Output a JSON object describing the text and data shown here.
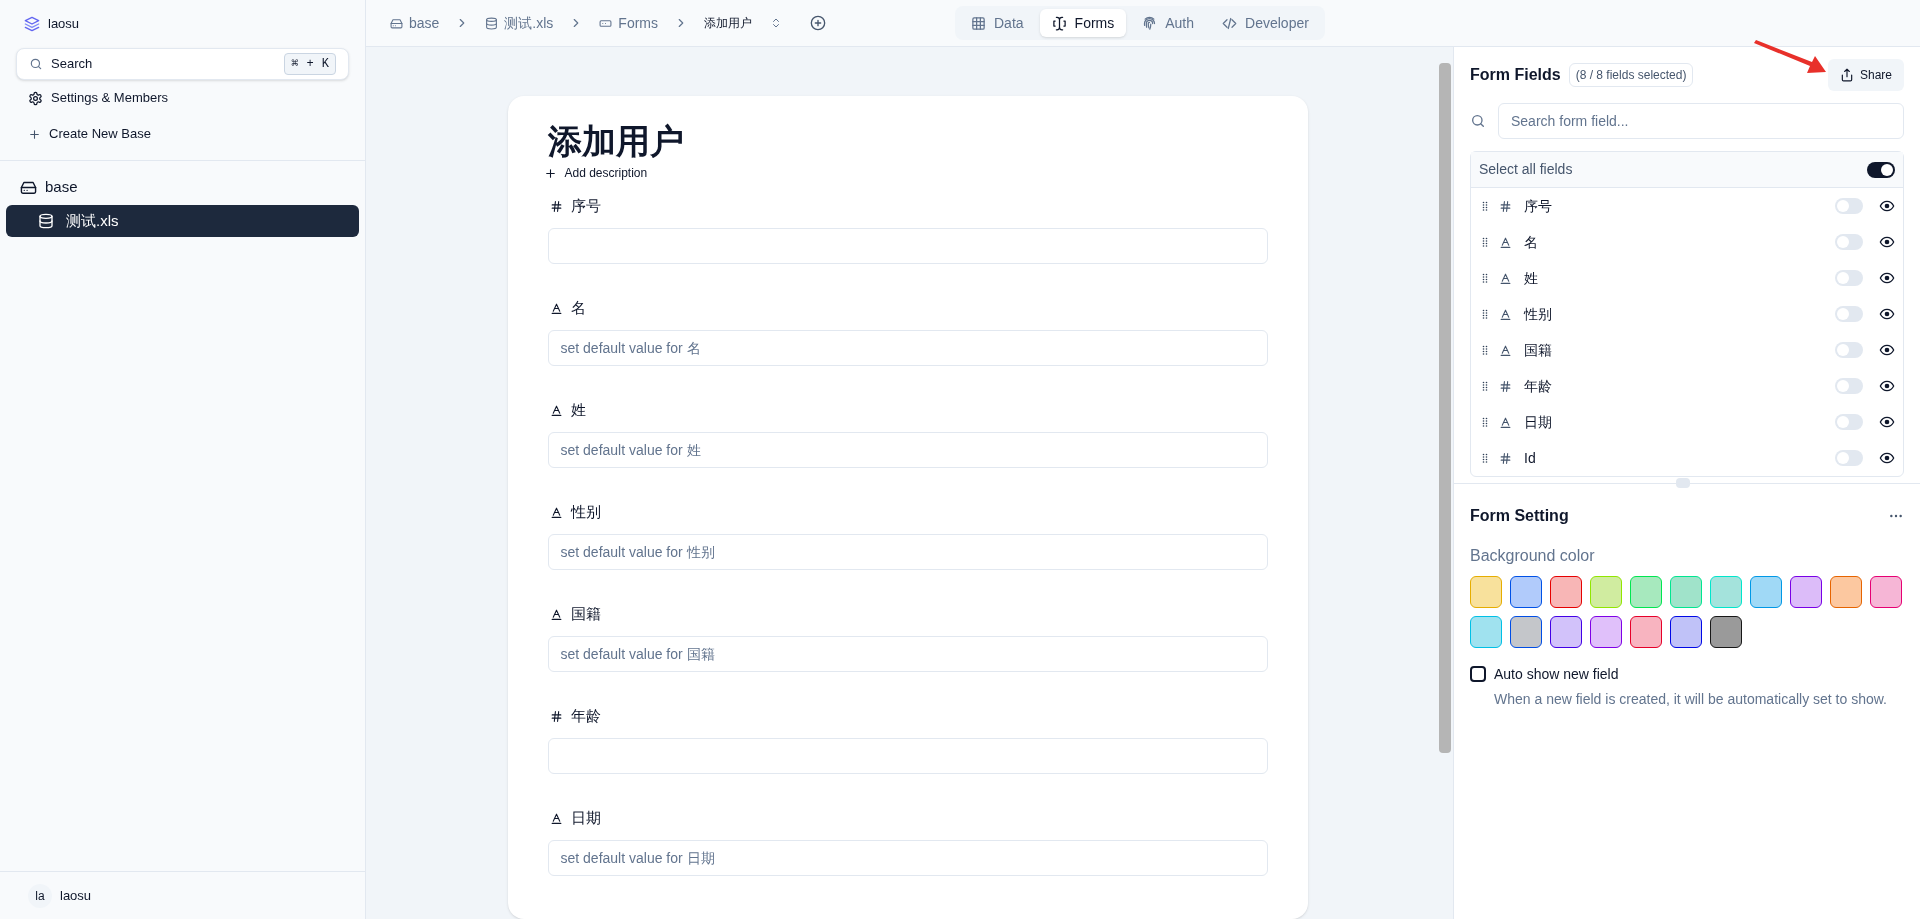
{
  "sidebar": {
    "workspace": "laosu",
    "search": {
      "placeholder": "Search",
      "shortcut_key1": "⌘",
      "shortcut_plus": "+",
      "shortcut_key2": "K"
    },
    "menu": [
      {
        "kind": "settings",
        "label": "Settings & Members"
      },
      {
        "kind": "create",
        "label": "Create New Base"
      }
    ],
    "base": {
      "label": "base",
      "tables": [
        {
          "label": "测试.xls",
          "selected": true
        }
      ]
    },
    "user": {
      "avatar": "la",
      "name": "laosu"
    }
  },
  "breadcrumb": [
    {
      "kind": "base",
      "label": "base"
    },
    {
      "kind": "table",
      "label": "测试.xls"
    },
    {
      "kind": "form",
      "label": "Forms"
    },
    {
      "kind": "view",
      "label": "添加用户"
    }
  ],
  "tabs": [
    {
      "kind": "data",
      "label": "Data",
      "selected": false
    },
    {
      "kind": "forms",
      "label": "Forms",
      "selected": true
    },
    {
      "kind": "auth",
      "label": "Auth",
      "selected": false
    },
    {
      "kind": "developer",
      "label": "Developer",
      "selected": false
    }
  ],
  "form": {
    "title": "添加用户",
    "add_description": "Add description",
    "fields": [
      {
        "kind": "number",
        "label": "序号"
      },
      {
        "kind": "text",
        "label": "名",
        "placeholder": "set default value for 名"
      },
      {
        "kind": "text",
        "label": "姓",
        "placeholder": "set default value for 姓"
      },
      {
        "kind": "text",
        "label": "性别",
        "placeholder": "set default value for 性别"
      },
      {
        "kind": "text",
        "label": "国籍",
        "placeholder": "set default value for 国籍"
      },
      {
        "kind": "number",
        "label": "年龄"
      },
      {
        "kind": "text",
        "label": "日期",
        "placeholder": "set default value for 日期"
      }
    ]
  },
  "form_fields": {
    "title": "Form Fields",
    "count": "(8 / 8 fields selected)",
    "share": "Share",
    "search": {
      "placeholder": "Search form field..."
    },
    "select_all": {
      "label": "Select all fields",
      "on": true
    },
    "items": [
      {
        "kind": "number",
        "label": "序号",
        "on": false
      },
      {
        "kind": "text",
        "label": "名",
        "on": false
      },
      {
        "kind": "text",
        "label": "姓",
        "on": false
      },
      {
        "kind": "text",
        "label": "性别",
        "on": false
      },
      {
        "kind": "text",
        "label": "国籍",
        "on": false
      },
      {
        "kind": "number",
        "label": "年龄",
        "on": false
      },
      {
        "kind": "text",
        "label": "日期",
        "on": false
      },
      {
        "kind": "number",
        "label": "Id",
        "on": false
      }
    ]
  },
  "form_setting": {
    "title": "Form Setting",
    "background_label": "Background color",
    "swatches": [
      {
        "color": "#f8e19c"
      },
      {
        "color": "#b1cbfb"
      },
      {
        "color": "#f8b6b6"
      },
      {
        "color": "#d0eca0"
      },
      {
        "color": "#a7e9be"
      },
      {
        "color": "#a0e3ca"
      },
      {
        "color": "#a4e3dc"
      },
      {
        "color": "#a0d9f6"
      },
      {
        "color": "#dcbcf9"
      },
      {
        "color": "#fcc8a0"
      },
      {
        "color": "#f6b6d6"
      },
      {
        "color": "#a0e2ef"
      },
      {
        "color": "#c4c6ca"
      },
      {
        "color": "#d2c2fa"
      },
      {
        "color": "#e0c0fa"
      },
      {
        "color": "#f8b4c0"
      },
      {
        "color": "#c0c2f8"
      },
      {
        "color": "#9a9a9a"
      }
    ],
    "auto_show": {
      "label": "Auto show new field",
      "description": "When a new field is created, it will be automatically set to show.",
      "checked": false
    }
  }
}
